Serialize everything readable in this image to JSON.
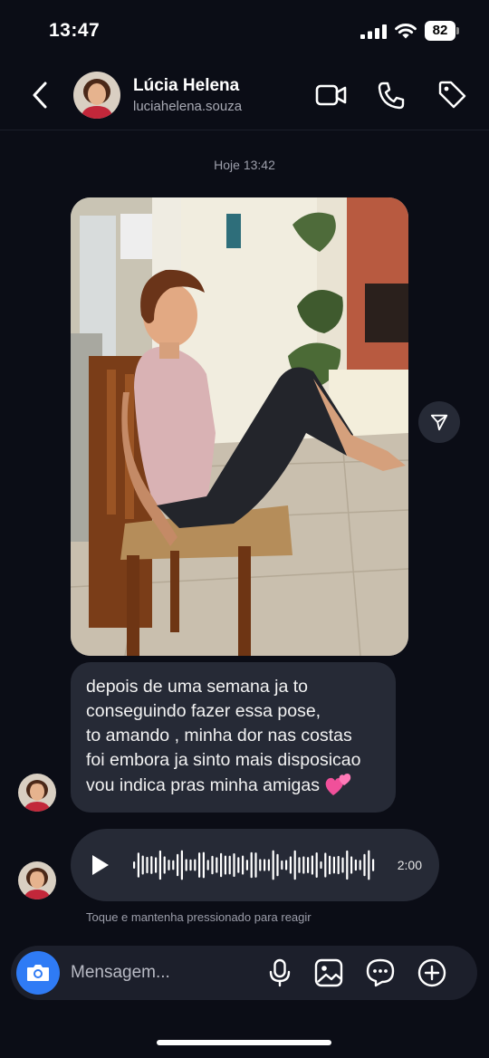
{
  "status_bar": {
    "time": "13:47",
    "battery": "82"
  },
  "header": {
    "contact_name": "Lúcia Helena",
    "contact_handle": "luciahelena.souza",
    "icons": [
      "back-icon",
      "video-call-icon",
      "phone-icon",
      "tag-icon"
    ]
  },
  "conversation": {
    "timestamp": "Hoje 13:42",
    "photo_message": {
      "share_icon": "send-icon"
    },
    "text_message": {
      "lines": [
        "depois de uma semana ja to",
        "conseguindo fazer essa pose,",
        "to amando , minha dor nas costas",
        "foi embora ja sinto mais disposicao",
        "vou indica pras minha amigas"
      ],
      "emoji": "two-hearts"
    },
    "voice_message": {
      "duration": "2:00"
    },
    "reaction_hint": "Toque e mantenha pressionado para reagir"
  },
  "composer": {
    "placeholder": "Mensagem...",
    "icons": [
      "camera-icon",
      "microphone-icon",
      "gallery-icon",
      "sticker-icon",
      "plus-icon"
    ]
  },
  "colors": {
    "background": "#0b0d16",
    "bubble": "#262a36",
    "accent": "#2f7bf5",
    "secondary_text": "#9c9eaa"
  }
}
